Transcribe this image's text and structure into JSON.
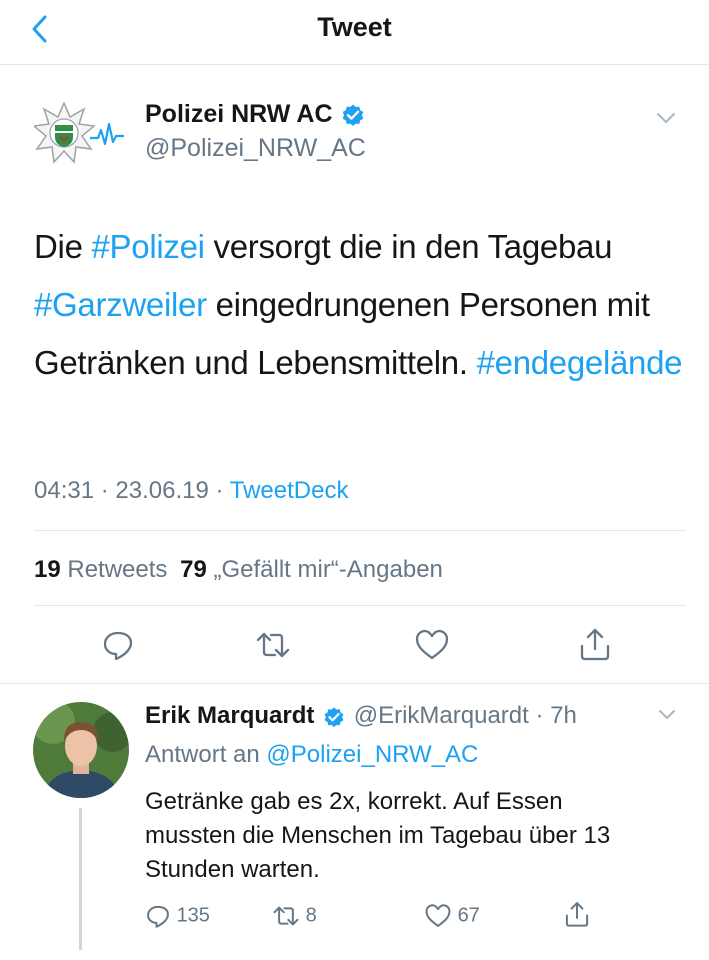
{
  "header": {
    "title": "Tweet"
  },
  "tweet": {
    "author_name": "Polizei NRW AC",
    "author_handle": "@Polizei_NRW_AC",
    "text_segments": [
      {
        "text": "Die ",
        "type": "text"
      },
      {
        "text": "#Polizei",
        "type": "hashtag"
      },
      {
        "text": " versorgt die in den Tagebau ",
        "type": "text"
      },
      {
        "text": "#Garzweiler",
        "type": "hashtag"
      },
      {
        "text": " eingedrungenen Personen mit Getränken und Lebensmitteln. ",
        "type": "text"
      },
      {
        "text": "#endegelände",
        "type": "hashtag"
      }
    ],
    "time": "04:31",
    "date": "23.06.19",
    "source": "TweetDeck",
    "retweets_count": "19",
    "retweets_label": "Retweets",
    "likes_count": "79",
    "likes_label": "„Gefällt mir“-Angaben"
  },
  "reply": {
    "author_name": "Erik Marquardt",
    "author_handle": "@ErikMarquardt",
    "age": "7h",
    "reply_to_label": "Antwort an",
    "reply_to_handle": "@Polizei_NRW_AC",
    "text": "Getränke gab es 2x, korrekt. Auf Essen mussten die Menschen im Tagebau über 13 Stunden warten.",
    "reply_count": "135",
    "retweet_count": "8",
    "like_count": "67"
  },
  "colors": {
    "accent": "#1da1f2",
    "muted": "#657786",
    "divider": "#e1e8ed"
  }
}
